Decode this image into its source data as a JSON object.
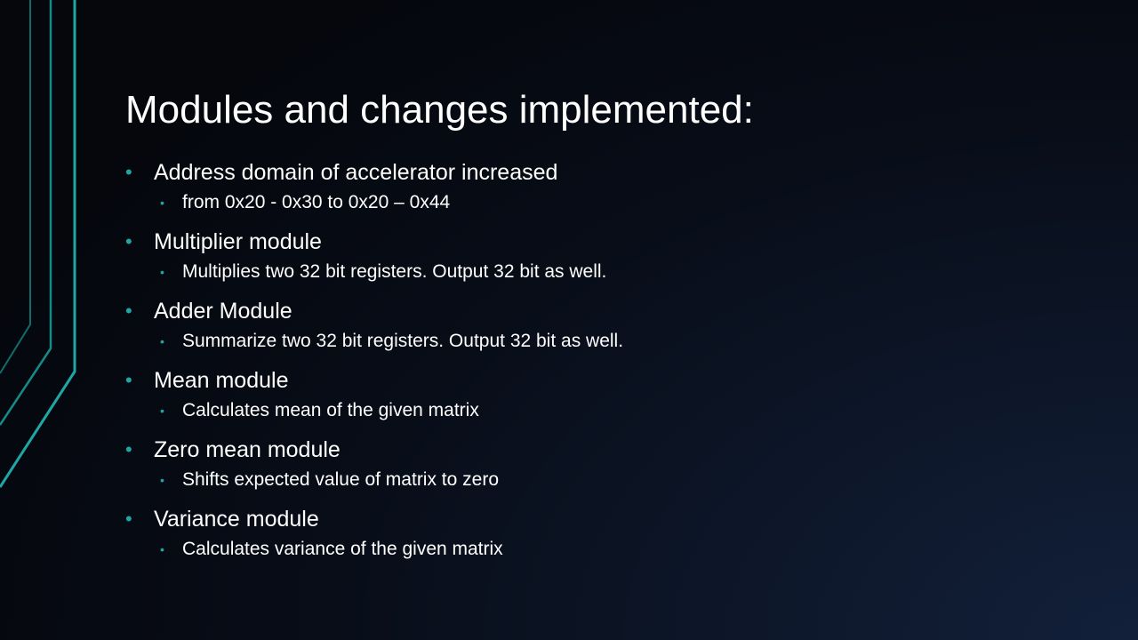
{
  "slide": {
    "title": "Modules and changes implemented:",
    "accent_color": "#1fa7a3",
    "bullet_icon": "bullet-dot",
    "bullets": [
      {
        "label": "Address domain of accelerator increased",
        "sub": "from 0x20 - 0x30 to 0x20 – 0x44"
      },
      {
        "label": "Multiplier module",
        "sub": "Multiplies two 32 bit registers. Output 32 bit as well."
      },
      {
        "label": "Adder Module",
        "sub": "Summarize two 32 bit registers. Output 32 bit as well."
      },
      {
        "label": "Mean module",
        "sub": "Calculates mean of the given matrix"
      },
      {
        "label": "Zero mean module",
        "sub": "Shifts expected value of matrix to zero"
      },
      {
        "label": "Variance module",
        "sub": "Calculates variance of the given matrix"
      }
    ]
  }
}
